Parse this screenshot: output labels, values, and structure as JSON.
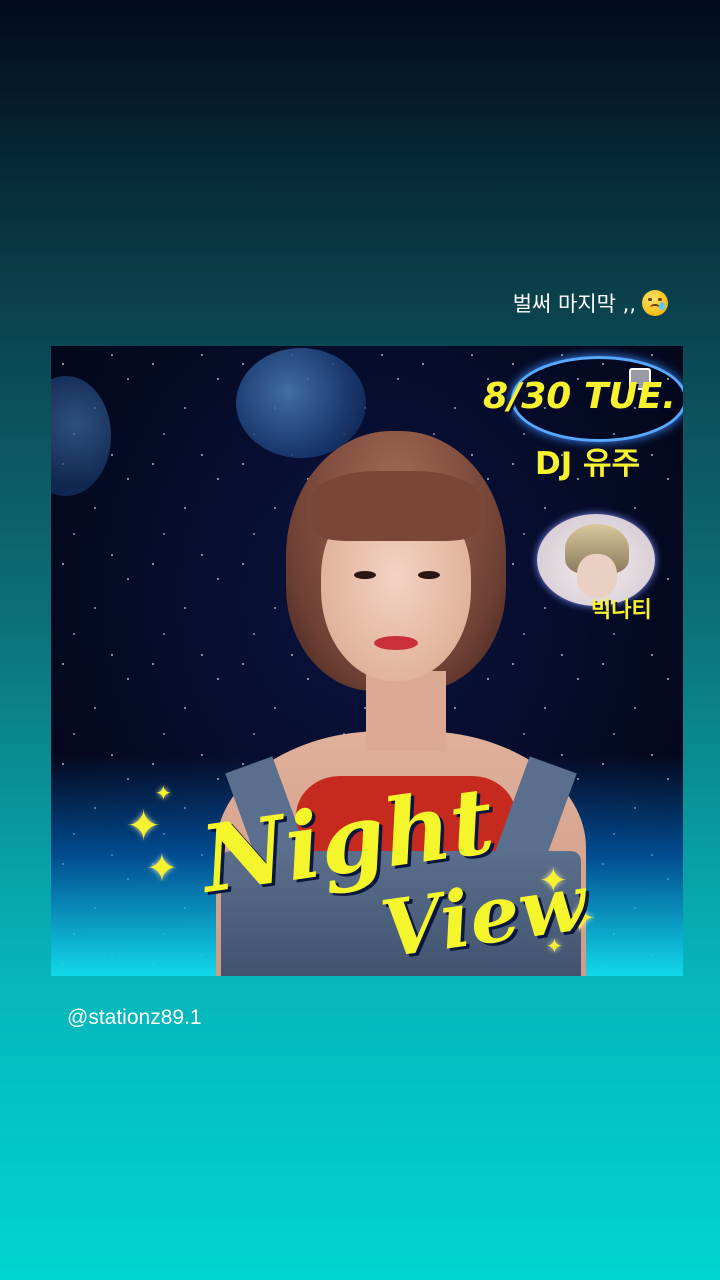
{
  "story": {
    "caption": "벌써 마지막 ,,",
    "caption_emoji": "crying-face-emoji",
    "mention": "@stationz89.1"
  },
  "post": {
    "date": "8/30 TUE.",
    "dj": "DJ 유주",
    "guest": "빅나티",
    "title_line1": "Night",
    "title_line2": "View"
  },
  "colors": {
    "title_yellow": "#f4f52a",
    "background_top": "#020a1f",
    "background_bottom": "#00d6d2"
  }
}
